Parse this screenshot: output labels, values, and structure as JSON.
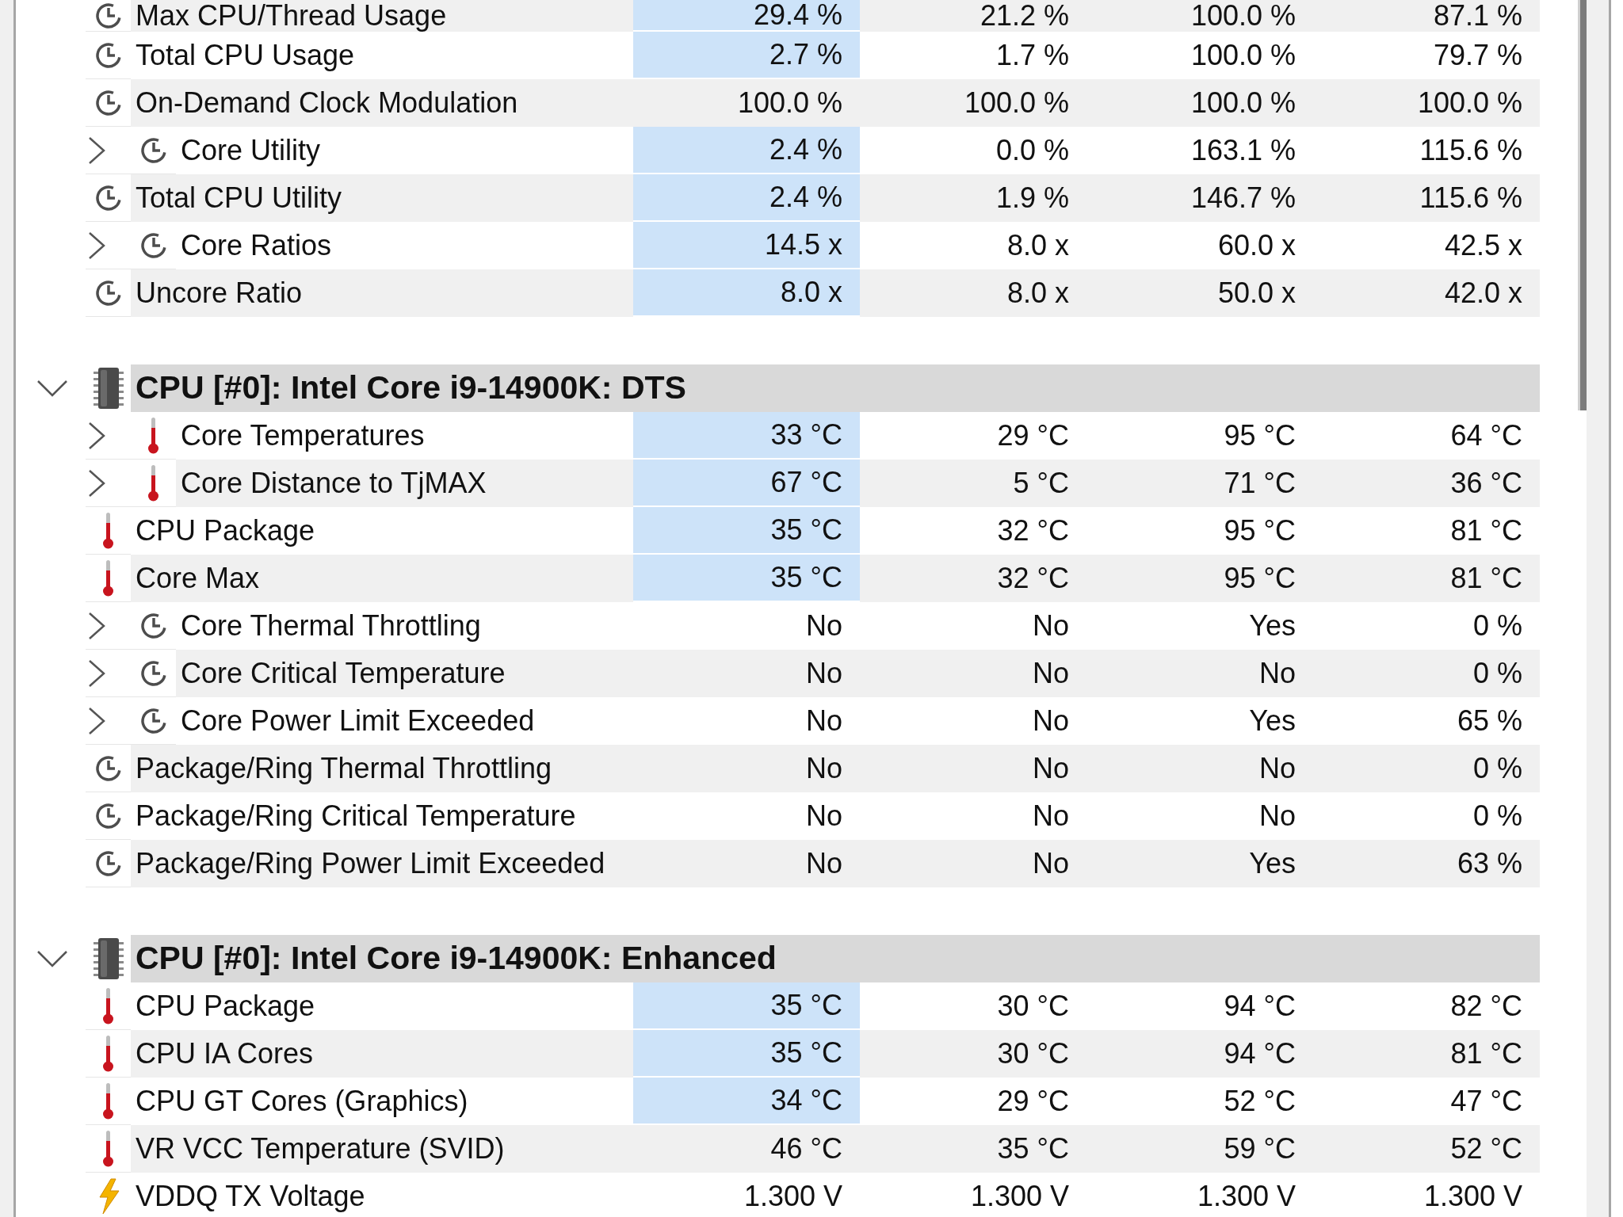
{
  "sensor_groups": [
    {
      "rows": [
        {
          "label": "Max CPU/Thread Usage",
          "kind": "usage",
          "expandable": false,
          "highlighted": true,
          "values": [
            "29.4 %",
            "21.2 %",
            "100.0 %",
            "87.1 %"
          ]
        },
        {
          "label": "Total CPU Usage",
          "kind": "usage",
          "expandable": false,
          "highlighted": true,
          "values": [
            "2.7 %",
            "1.7 %",
            "100.0 %",
            "79.7 %"
          ]
        },
        {
          "label": "On-Demand Clock Modulation",
          "kind": "usage",
          "expandable": false,
          "highlighted": false,
          "values": [
            "100.0 %",
            "100.0 %",
            "100.0 %",
            "100.0 %"
          ]
        },
        {
          "label": "Core Utility",
          "kind": "usage",
          "expandable": true,
          "expanded": false,
          "highlighted": true,
          "values": [
            "2.4 %",
            "0.0 %",
            "163.1 %",
            "115.6 %"
          ]
        },
        {
          "label": "Total CPU Utility",
          "kind": "usage",
          "expandable": false,
          "highlighted": true,
          "values": [
            "2.4 %",
            "1.9 %",
            "146.7 %",
            "115.6 %"
          ]
        },
        {
          "label": "Core Ratios",
          "kind": "usage",
          "expandable": true,
          "expanded": false,
          "highlighted": true,
          "values": [
            "14.5 x",
            "8.0 x",
            "60.0 x",
            "42.5 x"
          ]
        },
        {
          "label": "Uncore Ratio",
          "kind": "usage",
          "expandable": false,
          "highlighted": true,
          "values": [
            "8.0 x",
            "8.0 x",
            "50.0 x",
            "42.0 x"
          ]
        }
      ]
    },
    {
      "title": "CPU [#0]: Intel Core i9-14900K: DTS",
      "expanded": true,
      "rows": [
        {
          "label": "Core Temperatures",
          "kind": "temperature",
          "expandable": true,
          "expanded": false,
          "highlighted": true,
          "values": [
            "33 °C",
            "29 °C",
            "95 °C",
            "64 °C"
          ]
        },
        {
          "label": "Core Distance to TjMAX",
          "kind": "temperature",
          "expandable": true,
          "expanded": false,
          "highlighted": true,
          "values": [
            "67 °C",
            "5 °C",
            "71 °C",
            "36 °C"
          ]
        },
        {
          "label": "CPU Package",
          "kind": "temperature",
          "expandable": false,
          "highlighted": true,
          "values": [
            "35 °C",
            "32 °C",
            "95 °C",
            "81 °C"
          ]
        },
        {
          "label": "Core Max",
          "kind": "temperature",
          "expandable": false,
          "highlighted": true,
          "values": [
            "35 °C",
            "32 °C",
            "95 °C",
            "81 °C"
          ]
        },
        {
          "label": "Core Thermal Throttling",
          "kind": "usage",
          "expandable": true,
          "expanded": false,
          "highlighted": false,
          "values": [
            "No",
            "No",
            "Yes",
            "0 %"
          ]
        },
        {
          "label": "Core Critical Temperature",
          "kind": "usage",
          "expandable": true,
          "expanded": false,
          "highlighted": false,
          "values": [
            "No",
            "No",
            "No",
            "0 %"
          ]
        },
        {
          "label": "Core Power Limit Exceeded",
          "kind": "usage",
          "expandable": true,
          "expanded": false,
          "highlighted": false,
          "values": [
            "No",
            "No",
            "Yes",
            "65 %"
          ]
        },
        {
          "label": "Package/Ring Thermal Throttling",
          "kind": "usage",
          "expandable": false,
          "highlighted": false,
          "values": [
            "No",
            "No",
            "No",
            "0 %"
          ]
        },
        {
          "label": "Package/Ring Critical Temperature",
          "kind": "usage",
          "expandable": false,
          "highlighted": false,
          "values": [
            "No",
            "No",
            "No",
            "0 %"
          ]
        },
        {
          "label": "Package/Ring Power Limit Exceeded",
          "kind": "usage",
          "expandable": false,
          "highlighted": false,
          "values": [
            "No",
            "No",
            "Yes",
            "63 %"
          ]
        }
      ]
    },
    {
      "title": "CPU [#0]: Intel Core i9-14900K: Enhanced",
      "expanded": true,
      "rows": [
        {
          "label": "CPU Package",
          "kind": "temperature",
          "expandable": false,
          "highlighted": true,
          "values": [
            "35 °C",
            "30 °C",
            "94 °C",
            "82 °C"
          ]
        },
        {
          "label": "CPU IA Cores",
          "kind": "temperature",
          "expandable": false,
          "highlighted": true,
          "values": [
            "35 °C",
            "30 °C",
            "94 °C",
            "81 °C"
          ]
        },
        {
          "label": "CPU GT Cores (Graphics)",
          "kind": "temperature",
          "expandable": false,
          "highlighted": true,
          "values": [
            "34 °C",
            "29 °C",
            "52 °C",
            "47 °C"
          ]
        },
        {
          "label": "VR VCC Temperature (SVID)",
          "kind": "temperature",
          "expandable": false,
          "highlighted": false,
          "values": [
            "46 °C",
            "35 °C",
            "59 °C",
            "52 °C"
          ]
        },
        {
          "label": "VDDQ TX Voltage",
          "kind": "voltage",
          "expandable": false,
          "highlighted": false,
          "values": [
            "1.300 V",
            "1.300 V",
            "1.300 V",
            "1.300 V"
          ]
        }
      ]
    }
  ]
}
